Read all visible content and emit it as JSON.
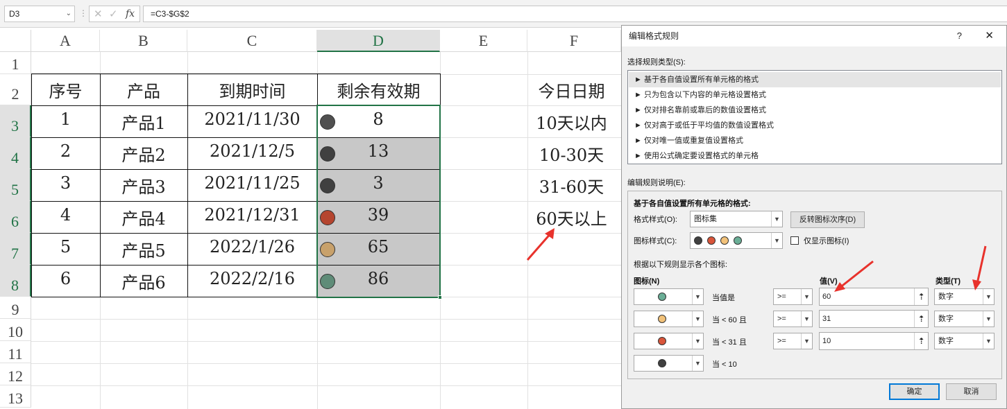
{
  "formula_bar": {
    "name_box": "D3",
    "formula": "=C3-$G$2",
    "cancel_icon": "✕",
    "enter_icon": "✓",
    "fx_icon": "fx"
  },
  "sheet": {
    "columns": [
      "A",
      "B",
      "C",
      "D",
      "E",
      "F"
    ],
    "rows": [
      "1",
      "2",
      "3",
      "4",
      "5",
      "6",
      "7",
      "8",
      "9",
      "10",
      "11",
      "12",
      "13"
    ],
    "selected_column": "D",
    "headers": [
      "序号",
      "产品",
      "到期时间",
      "剩余有效期"
    ],
    "data": [
      {
        "no": "1",
        "product": "产品1",
        "date": "2021/11/30",
        "remaining": "8",
        "icon_color": "#505050"
      },
      {
        "no": "2",
        "product": "产品2",
        "date": "2021/12/5",
        "remaining": "13",
        "icon_color": "#404040"
      },
      {
        "no": "3",
        "product": "产品3",
        "date": "2021/11/25",
        "remaining": "3",
        "icon_color": "#404040"
      },
      {
        "no": "4",
        "product": "产品4",
        "date": "2021/12/31",
        "remaining": "39",
        "icon_color": "#b5452f"
      },
      {
        "no": "5",
        "product": "产品5",
        "date": "2022/1/26",
        "remaining": "65",
        "icon_color": "#c8a16b"
      },
      {
        "no": "6",
        "product": "产品6",
        "date": "2022/2/16",
        "remaining": "86",
        "icon_color": "#5f8c78"
      }
    ],
    "f_column": [
      "今日日期",
      "10天以内",
      "10-30天",
      "31-60天",
      "60天以上"
    ]
  },
  "dialog": {
    "title": "编辑格式规则",
    "help_icon": "?",
    "close_icon": "✕",
    "rule_type_label": "选择规则类型(S):",
    "rule_types": [
      "► 基于各自值设置所有单元格的格式",
      "► 只为包含以下内容的单元格设置格式",
      "► 仅对排名靠前或靠后的数值设置格式",
      "► 仅对高于或低于平均值的数值设置格式",
      "► 仅对唯一值或重复值设置格式",
      "► 使用公式确定要设置格式的单元格"
    ],
    "edit_desc_label": "编辑规则说明(E):",
    "section_title": "基于各自值设置所有单元格的格式:",
    "format_style_label": "格式样式(O):",
    "format_style_value": "图标集",
    "reverse_button": "反转图标次序(D)",
    "icon_style_label": "图标样式(C):",
    "icon_style_colors": [
      "#404040",
      "#d9553a",
      "#f2c27a",
      "#6aae96"
    ],
    "show_icon_only_label": "仅显示图标(I)",
    "show_icon_only_checked": false,
    "rules_caption": "根据以下规则显示各个图标:",
    "icon_col_header": "图标(N)",
    "value_col_header": "值(V)",
    "type_col_header": "类型(T)",
    "icon_rows": [
      {
        "color": "#6aae96",
        "condition": "当值是",
        "operator": ">=",
        "value": "60",
        "type": "数字"
      },
      {
        "color": "#f2c27a",
        "condition": "当 < 60 且",
        "operator": ">=",
        "value": "31",
        "type": "数字"
      },
      {
        "color": "#d9553a",
        "condition": "当 < 31 且",
        "operator": ">=",
        "value": "10",
        "type": "数字"
      },
      {
        "color": "#404040",
        "condition": "当 < 10",
        "operator": "",
        "value": "",
        "type": ""
      }
    ],
    "ok_button": "确定",
    "cancel_button": "取消"
  }
}
